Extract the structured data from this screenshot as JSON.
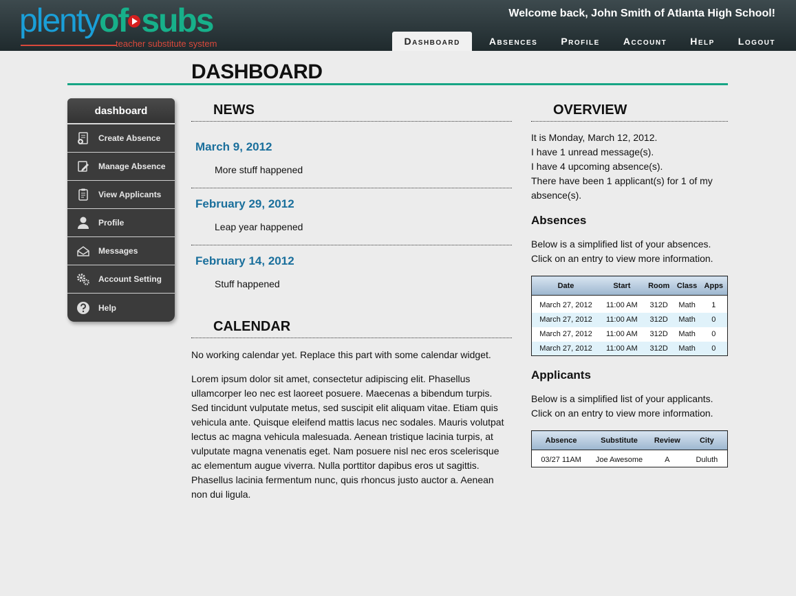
{
  "header": {
    "logo_part1": "plenty",
    "logo_part2": "of",
    "logo_part3": "subs",
    "logo_tagline": "teacher substitute system",
    "welcome": "Welcome back, John Smith of Atlanta High School!",
    "nav": [
      {
        "label": "Dashboard",
        "active": true
      },
      {
        "label": "Absences"
      },
      {
        "label": "Profile"
      },
      {
        "label": "Account"
      },
      {
        "label": "Help"
      },
      {
        "label": "Logout"
      }
    ]
  },
  "page_title": "DASHBOARD",
  "sidebar": {
    "title": "dashboard",
    "items": [
      {
        "label": "Create Absence",
        "icon": "create-absence-icon"
      },
      {
        "label": "Manage Absence",
        "icon": "edit-icon"
      },
      {
        "label": "View Applicants",
        "icon": "clipboard-icon"
      },
      {
        "label": "Profile",
        "icon": "person-icon"
      },
      {
        "label": "Messages",
        "icon": "envelope-icon"
      },
      {
        "label": "Account Setting",
        "icon": "gears-icon"
      },
      {
        "label": "Help",
        "icon": "question-icon"
      }
    ]
  },
  "news": {
    "heading": "NEWS",
    "items": [
      {
        "date": "March 9, 2012",
        "text": "More stuff happened"
      },
      {
        "date": "February 29, 2012",
        "text": "Leap year happened"
      },
      {
        "date": "February 14, 2012",
        "text": "Stuff happened"
      }
    ]
  },
  "calendar": {
    "heading": "CALENDAR",
    "note": "No working calendar yet. Replace this part with some calendar widget.",
    "lorem": "Lorem ipsum dolor sit amet, consectetur adipiscing elit. Phasellus ullamcorper leo nec est laoreet posuere. Maecenas a bibendum turpis. Sed tincidunt vulputate metus, sed suscipit elit aliquam vitae. Etiam quis vehicula ante. Quisque eleifend mattis lacus nec sodales. Mauris volutpat lectus ac magna vehicula malesuada. Aenean tristique lacinia turpis, at vulputate magna venenatis eget. Nam posuere nisl nec eros scelerisque ac elementum augue viverra. Nulla porttitor dapibus eros ut sagittis. Phasellus lacinia fermentum nunc, quis rhoncus justo auctor a. Aenean non dui ligula."
  },
  "overview": {
    "heading": "OVERVIEW",
    "lines": [
      "It is Monday, March 12, 2012.",
      "I have 1 unread message(s).",
      "I have 4 upcoming absence(s).",
      "There have been 1 applicant(s) for 1 of my absence(s)."
    ],
    "absences": {
      "heading": "Absences",
      "intro": "Below is a simplified list of your absences. Click on an entry to view more information.",
      "columns": [
        "Date",
        "Start",
        "Room",
        "Class",
        "Apps"
      ],
      "rows": [
        [
          "March 27, 2012",
          "11:00 AM",
          "312D",
          "Math",
          "1"
        ],
        [
          "March 27, 2012",
          "11:00 AM",
          "312D",
          "Math",
          "0"
        ],
        [
          "March 27, 2012",
          "11:00 AM",
          "312D",
          "Math",
          "0"
        ],
        [
          "March 27, 2012",
          "11:00 AM",
          "312D",
          "Math",
          "0"
        ]
      ]
    },
    "applicants": {
      "heading": "Applicants",
      "intro": "Below is a simplified list of your applicants. Click on an entry to view more information.",
      "columns": [
        "Absence",
        "Substitute",
        "Review",
        "City"
      ],
      "rows": [
        [
          "03/27 11AM",
          "Joe Awesome",
          "A",
          "Duluth"
        ]
      ]
    }
  }
}
